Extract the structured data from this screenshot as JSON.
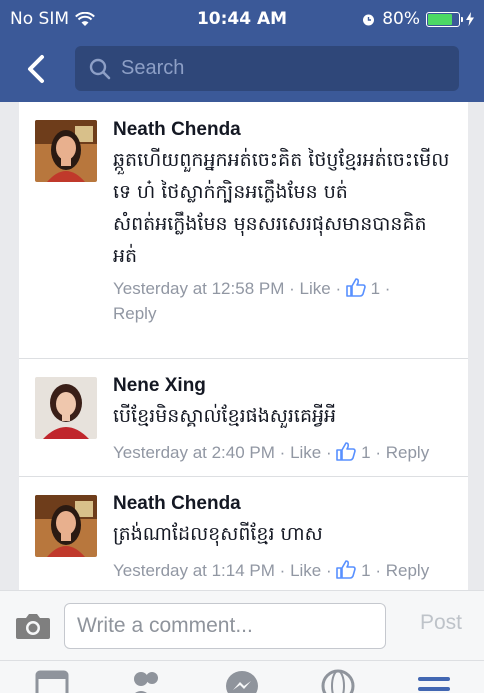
{
  "status": {
    "carrier": "No SIM",
    "time": "10:44 AM",
    "battery": "80%",
    "battery_level": 0.8
  },
  "nav": {
    "search_placeholder": "Search"
  },
  "comments": [
    {
      "name": "Neath Chenda",
      "text": "ឆ្កួតហើយពួកអ្នកអត់ចេះគិត ថៃប្ញខ្មែរអត់ចេះមើលទេ ហ៎ ថៃស្លាក់ក្បិនអក្លេឹងមែន បត់សំពត់អក្លេឹងមែន មុនសរសេរផុសមានបានគិត អត់",
      "time": "Yesterday at 12:58 PM",
      "sep1": "·",
      "like": "Like",
      "sep2": "·",
      "likes": "1",
      "sep3": "·",
      "reply": "Reply"
    },
    {
      "name": "Nene Xing",
      "text": "បើខ្មែរមិនស្គាល់ខ្មែរផងសួរគេអ្វីអី",
      "time": "Yesterday at 2:40 PM",
      "sep1": "·",
      "like": "Like",
      "sep2": "·",
      "likes": "1",
      "sep3": "·",
      "reply": "Reply"
    },
    {
      "name": "Neath Chenda",
      "text": "ត្រង់ណាដែលខុសពីខ្មែរ ហាស",
      "time": "Yesterday at 1:14 PM",
      "sep1": "·",
      "like": "Like",
      "sep2": "·",
      "likes": "1",
      "sep3": "·",
      "reply": "Reply"
    }
  ],
  "composer": {
    "placeholder": "Write a comment...",
    "post_label": "Post"
  },
  "colors": {
    "brand": "#3b5998",
    "link_blue": "#5890ff",
    "battery_green": "#4cd964"
  }
}
